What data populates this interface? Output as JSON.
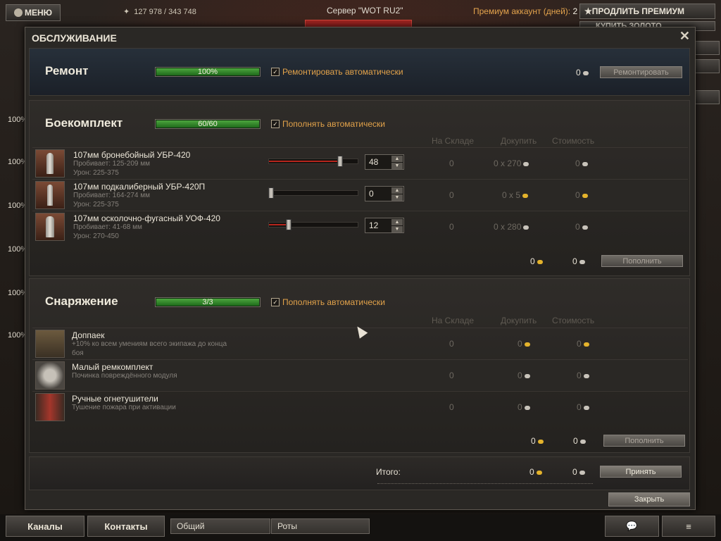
{
  "topbar": {
    "menu": "МЕНЮ",
    "exp": "127 978 / 343 748",
    "server": "Сервер \"WOT RU2\"",
    "premium_label": "Премиум аккаунт (дней):",
    "premium_days": "2",
    "buy_premium": "ПРОДЛИТЬ ПРЕМИУМ",
    "buy_gold": "КУПИТЬ ЗОЛОТО"
  },
  "side": {
    "pcts": [
      "100%",
      "100%",
      "100%",
      "100%",
      "100%",
      "100%",
      "100%",
      "100%"
    ]
  },
  "dialog": {
    "title": "ОБСЛУЖИВАНИЕ",
    "close_x": "✕",
    "repair": {
      "title": "Ремонт",
      "progress_label": "100%",
      "progress": 1.0,
      "auto_label": "Ремонтировать автоматически",
      "auto": true,
      "cost": "0",
      "button": "Ремонтировать"
    },
    "ammo": {
      "title": "Боекомплект",
      "progress_label": "60/60",
      "progress": 1.0,
      "auto_label": "Пополнять автоматически",
      "auto": true,
      "col_stock": "На Складе",
      "col_buy": "Докупить",
      "col_cost": "Стоимость",
      "rows": [
        {
          "name": "107мм бронебойный УБР-420",
          "pen": "Пробивает: 125-209 мм",
          "dmg": "Урон: 225-375",
          "count": "48",
          "slider": 0.8,
          "stock": "0",
          "buy": "0 x 270",
          "cost": "0"
        },
        {
          "name": "107мм подкалиберный УБР-420П",
          "pen": "Пробивает: 164-274 мм",
          "dmg": "Урон: 225-375",
          "count": "0",
          "slider": 0.0,
          "stock": "0",
          "buy": "0 x 5",
          "cost": "0"
        },
        {
          "name": "107мм осколочно-фугасный УОФ-420",
          "pen": "Пробивает: 41-68 мм",
          "dmg": "Урон: 270-450",
          "count": "12",
          "slider": 0.2,
          "stock": "0",
          "buy": "0 x 280",
          "cost": "0"
        }
      ],
      "total_gold": "0",
      "total_credits": "0",
      "button": "Пополнить"
    },
    "equip": {
      "title": "Снаряжение",
      "progress_label": "3/3",
      "progress": 1.0,
      "auto_label": "Пополнять автоматически",
      "auto": true,
      "col_stock": "На Складе",
      "col_buy": "Докупить",
      "col_cost": "Стоимость",
      "rows": [
        {
          "name": "Доппаек",
          "desc1": "+10% ко всем умениям всего экипажа до конца",
          "desc2": "боя",
          "stock": "0",
          "buy": "0",
          "cost": "0"
        },
        {
          "name": "Малый ремкомплект",
          "desc1": "Починка повреждённого модуля",
          "desc2": "",
          "stock": "0",
          "buy": "0",
          "cost": "0"
        },
        {
          "name": "Ручные огнетушители",
          "desc1": "Тушение пожара при активации",
          "desc2": "",
          "stock": "0",
          "buy": "0",
          "cost": "0"
        }
      ],
      "total_gold": "0",
      "total_credits": "0",
      "button": "Пополнить"
    },
    "total": {
      "label": "Итого:",
      "gold": "0",
      "credits": "0",
      "accept": "Принять"
    },
    "close_button": "Закрыть"
  },
  "bottombar": {
    "channels": "Каналы",
    "contacts": "Контакты",
    "chat_general": "Общий",
    "chat_company": "Роты"
  }
}
